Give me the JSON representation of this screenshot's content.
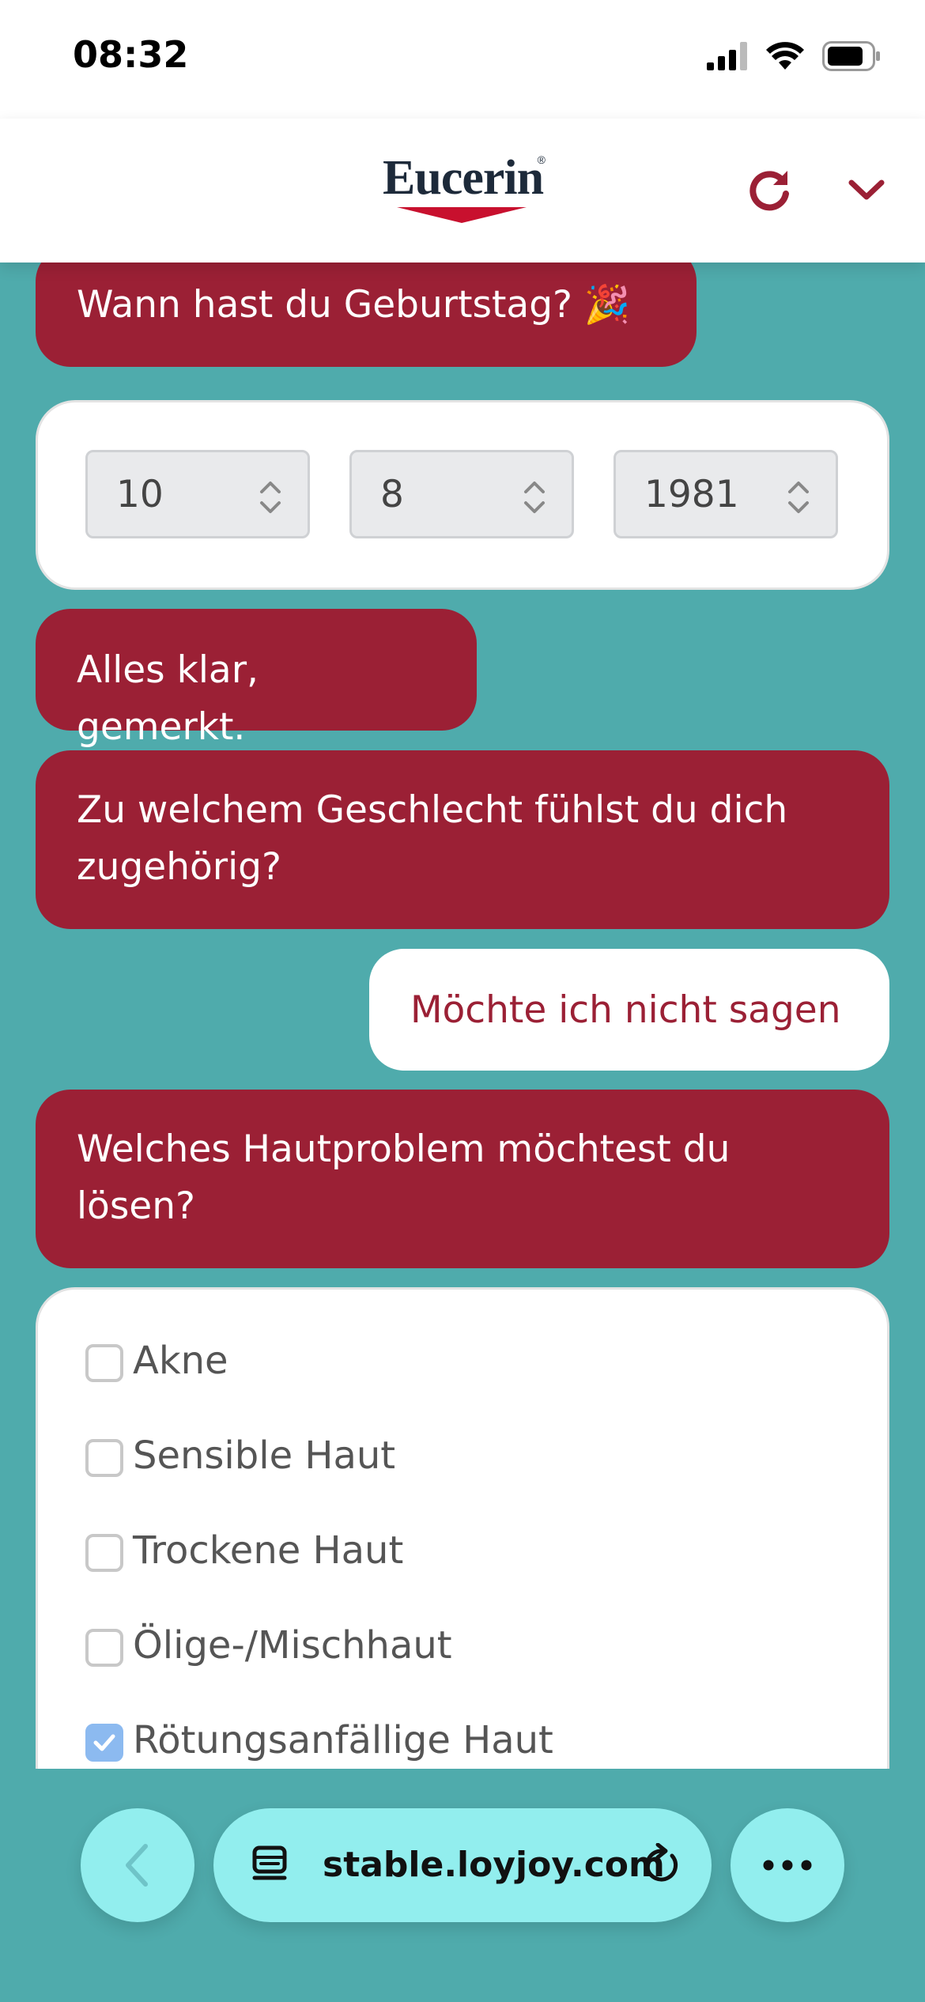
{
  "status_bar": {
    "time": "08:32"
  },
  "header": {
    "brand": "Eucerin",
    "registered_mark": "®",
    "brand_color": "#9b2035"
  },
  "chat": {
    "birthday_question": "Wann hast du Geburtstag? 🎉",
    "birthday": {
      "day": "10",
      "month": "8",
      "year": "1981"
    },
    "confirmation": "Alles klar, gemerkt.",
    "gender_question": "Zu welchem Geschlecht fühlst du dich zugehörig?",
    "gender_answer": "Möchte ich nicht sagen",
    "skin_question": "Welches Hautproblem möchtest du lösen?",
    "skin_options": [
      {
        "label": "Akne",
        "checked": false
      },
      {
        "label": "Sensible Haut",
        "checked": false
      },
      {
        "label": "Trockene Haut",
        "checked": false
      },
      {
        "label": "Ölige-/Mischhaut",
        "checked": false
      },
      {
        "label": "Rötungsanfällige Haut",
        "checked": true
      }
    ]
  },
  "browser": {
    "url": "stable.loyjoy.com"
  },
  "colors": {
    "bot_bubble": "#9b2035",
    "background": "#4fabac",
    "toolbar": "#92eeee",
    "checkbox_checked": "#8cbaf0"
  }
}
